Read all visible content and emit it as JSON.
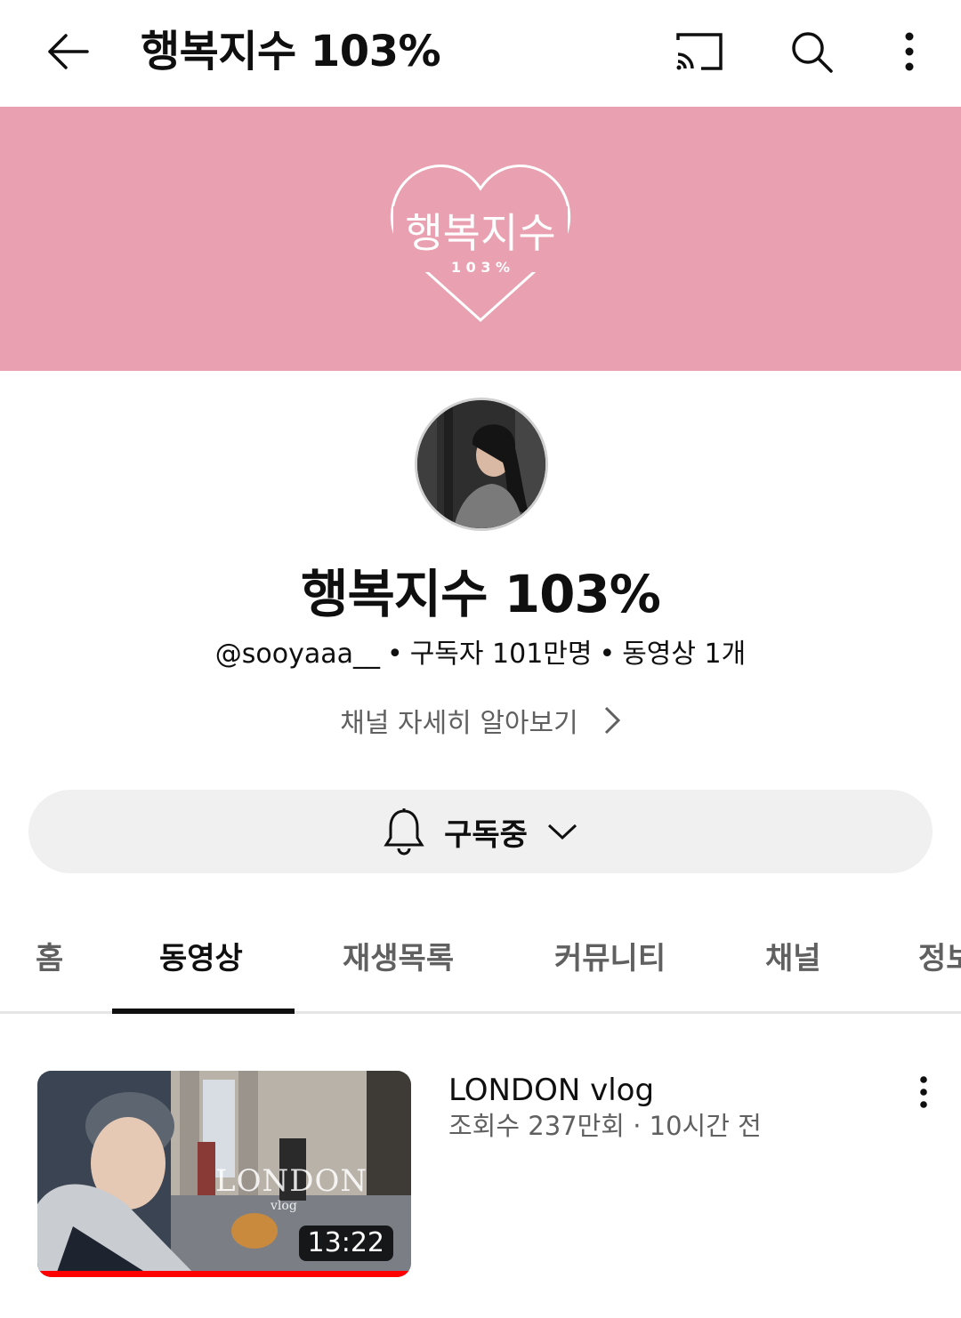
{
  "appbar": {
    "title": "행복지수 103%",
    "icons": [
      "back-arrow-icon",
      "cast-icon",
      "search-icon",
      "more-vert-icon"
    ]
  },
  "banner": {
    "color": "#e9a0b0",
    "logo_text": "행복지수",
    "logo_sub": "1 0 3 %"
  },
  "channel": {
    "name": "행복지수 103%",
    "handle": "@sooyaaa__",
    "subscribers": "구독자 101만명",
    "video_count": "동영상 1개",
    "separator": "•",
    "more_info_label": "채널 자세히 알아보기"
  },
  "subscribe": {
    "label": "구독중"
  },
  "tabs": [
    {
      "label": "홈",
      "active": false
    },
    {
      "label": "동영상",
      "active": true
    },
    {
      "label": "재생목록",
      "active": false
    },
    {
      "label": "커뮤니티",
      "active": false
    },
    {
      "label": "채널",
      "active": false
    },
    {
      "label": "정보",
      "active": false
    }
  ],
  "videos": [
    {
      "title": "LONDON vlog",
      "meta": "조회수 237만회 · 10시간 전",
      "duration": "13:22",
      "thumbnail_text": "LONDON",
      "thumbnail_sub": "vlog",
      "watched_fraction": 1.0
    }
  ],
  "colors": {
    "accent_progress": "#ff0000",
    "text_primary": "#0f0f0f",
    "text_secondary": "#606060"
  }
}
